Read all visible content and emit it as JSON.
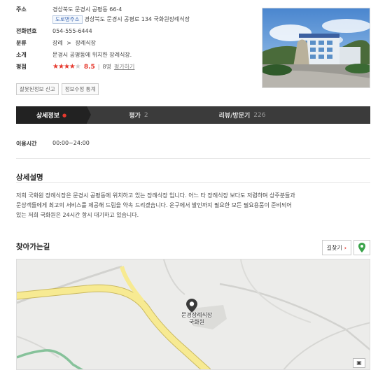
{
  "info": {
    "address_label": "주소",
    "address": "경상북도 문경시 공평동 66-4",
    "road_tag": "도로명주소",
    "road_address": "경상북도 문경시 공평로 134 국화원장례식장",
    "phone_label": "전화번호",
    "phone": "054-555-6444",
    "category_label": "분류",
    "category_parent": "장례",
    "category_sep": ">",
    "category_child": "장례식장",
    "intro_label": "소개",
    "intro": "문경시 공평동에 위치한 장례식장.",
    "rating_label": "평점",
    "rating_score": "8.5",
    "rating_count": "8명",
    "rating_sep": "|",
    "rating_link": "평가하기",
    "rating_stars": 4
  },
  "buttons": {
    "report": "잘못된정보 신고",
    "edit_history": "정보수정 통계"
  },
  "tabs": [
    {
      "label": "상세정보",
      "count": ""
    },
    {
      "label": "평가",
      "count": "2"
    },
    {
      "label": "리뷰/방문기",
      "count": "226"
    }
  ],
  "hours": {
    "label": "이용시간",
    "value": "00:00~24:00"
  },
  "detail": {
    "title": "상세설명",
    "line1": "저희 국화원 장례식장은 문경시 공평동에 위치하고 있는 장례식장 입니다. 어느 타 장례식장 보다도 저렴하며 상주분들과",
    "line2": "문상객들에게 최고의 서비스를 제공해 드림을 약속 드리겠습니다. 운구에서 발인까지 필요한 모든 필요용품이 준비되어",
    "line3": "있는 저희 국화원은 24시간 항시 대기하고 있습니다."
  },
  "directions": {
    "title": "찾아가는길",
    "route_button": "길찾기",
    "map_label_line1": "문경장례식장",
    "map_label_line2": "국화원"
  },
  "colors": {
    "accent": "#e6392e",
    "tab_bar": "#3b3b3b",
    "tab_active": "#222222",
    "map_road": "#f5e58a",
    "map_green_road": "#86c29a"
  }
}
